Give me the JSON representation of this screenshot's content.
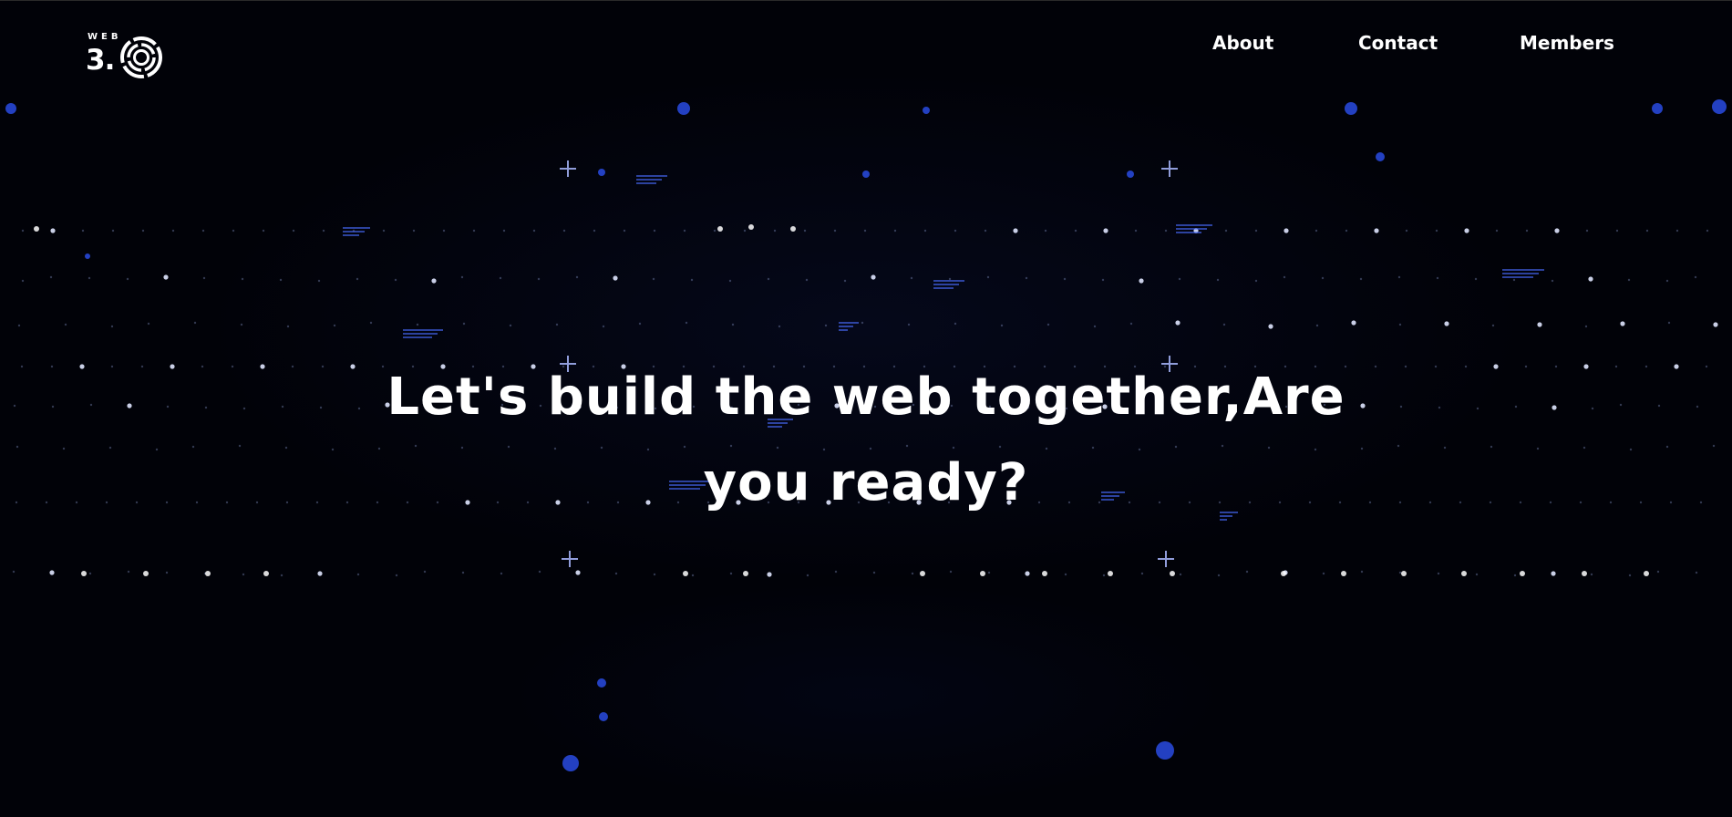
{
  "brand": {
    "logo_top_text": "WEB",
    "logo_main_text": "3.",
    "ring_icon": "concentric-ring-icon"
  },
  "nav": {
    "items": [
      {
        "label": "About"
      },
      {
        "label": "Contact"
      },
      {
        "label": "Members"
      }
    ]
  },
  "hero": {
    "headline": "Let's build the web together,Are you ready?"
  },
  "colors": {
    "background": "#010208",
    "text": "#ffffff",
    "particle_accent": "#2f56ff"
  }
}
